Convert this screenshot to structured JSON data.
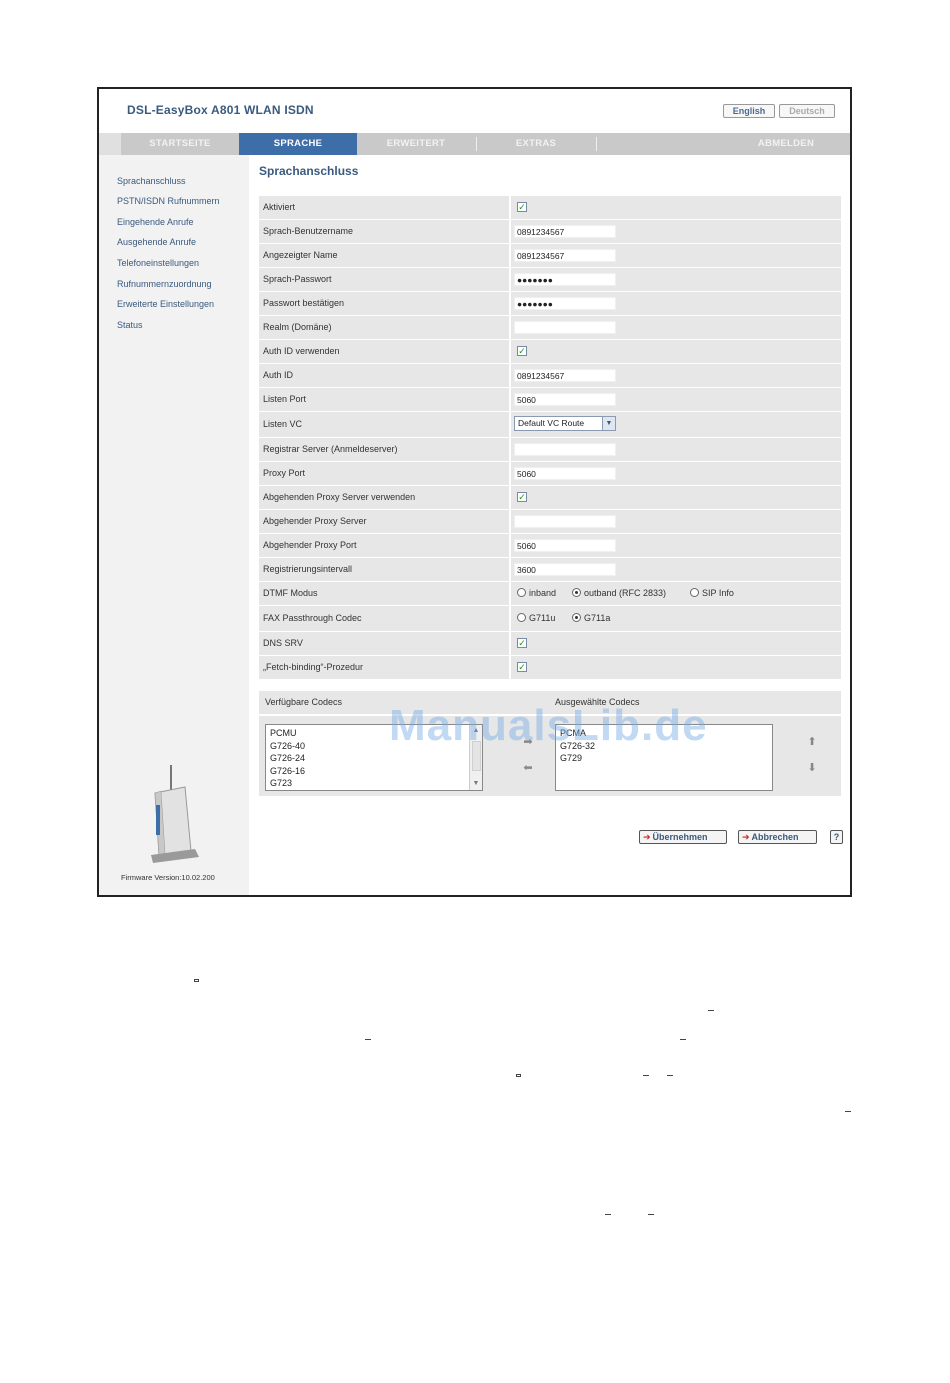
{
  "app": {
    "title": "DSL-EasyBox A801 WLAN ISDN",
    "lang_english": "English",
    "lang_deutsch": "Deutsch",
    "accent_color": "#3d6ea8"
  },
  "nav": {
    "tabs": [
      "STARTSEITE",
      "SPRACHE",
      "ERWEITERT",
      "EXTRAS",
      "ABMELDEN"
    ],
    "active": "SPRACHE"
  },
  "sidebar": {
    "items": [
      "Sprachanschluss",
      "PSTN/ISDN Rufnummern",
      "Eingehende Anrufe",
      "Ausgehende Anrufe",
      "Telefoneinstellungen",
      "Rufnummernzuordnung",
      "Erweiterte Einstellungen",
      "Status"
    ],
    "firmware": "Firmware Version:10.02.200"
  },
  "main": {
    "heading": "Sprachanschluss",
    "rows": {
      "aktiviert": {
        "label": "Aktiviert",
        "checked": true
      },
      "benutzername": {
        "label": "Sprach-Benutzername",
        "value": "0891234567"
      },
      "angezeigter_name": {
        "label": "Angezeigter Name",
        "value": "0891234567"
      },
      "passwort": {
        "label": "Sprach-Passwort",
        "value": "●●●●●●●"
      },
      "passwort_bestaetigen": {
        "label": "Passwort bestätigen",
        "value": "●●●●●●●"
      },
      "realm": {
        "label": "Realm (Domäne)",
        "value": ""
      },
      "auth_id_verwenden": {
        "label": "Auth ID verwenden",
        "checked": true
      },
      "auth_id": {
        "label": "Auth ID",
        "value": "0891234567"
      },
      "listen_port": {
        "label": "Listen Port",
        "value": "5060"
      },
      "listen_vc": {
        "label": "Listen VC",
        "value": "Default VC Route"
      },
      "registrar": {
        "label": "Registrar Server (Anmeldeserver)",
        "value": ""
      },
      "proxy_port": {
        "label": "Proxy Port",
        "value": "5060"
      },
      "proxy_verwenden": {
        "label": "Abgehenden Proxy Server verwenden",
        "checked": true
      },
      "proxy_server": {
        "label": "Abgehender Proxy Server",
        "value": ""
      },
      "proxy_port_ab": {
        "label": "Abgehender Proxy Port",
        "value": "5060"
      },
      "reg_intervall": {
        "label": "Registrierungsintervall",
        "value": "3600"
      },
      "dtmf": {
        "label": "DTMF Modus",
        "options": [
          "inband",
          "outband (RFC 2833)",
          "SIP Info"
        ],
        "selected": "outband (RFC 2833)"
      },
      "fax": {
        "label": "FAX Passthrough Codec",
        "options": [
          "G711u",
          "G711a"
        ],
        "selected": "G711a"
      },
      "dns_srv": {
        "label": "DNS SRV",
        "checked": true
      },
      "fetch_binding": {
        "label": "„Fetch-binding“-Prozedur",
        "checked": true
      }
    },
    "codecs": {
      "available_label": "Verfügbare Codecs",
      "selected_label": "Ausgewählte Codecs",
      "available": [
        "PCMU",
        "G726-40",
        "G726-24",
        "G726-16",
        "G723"
      ],
      "selected": [
        "PCMA",
        "G726-32",
        "G729"
      ]
    },
    "buttons": {
      "apply": "Übernehmen",
      "cancel": "Abbrechen",
      "help": "?"
    }
  },
  "watermark": "ManualsLib.de"
}
